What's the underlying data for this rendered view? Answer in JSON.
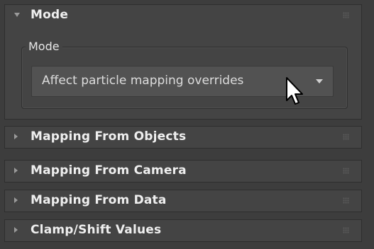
{
  "rollouts": [
    {
      "title": "Mode",
      "expanded": true
    },
    {
      "title": "Mapping From Objects",
      "expanded": false
    },
    {
      "title": "Mapping From Camera",
      "expanded": false
    },
    {
      "title": "Mapping From Data",
      "expanded": false
    },
    {
      "title": "Clamp/Shift Values",
      "expanded": false
    }
  ],
  "mode_group": {
    "label": "Mode",
    "dropdown": {
      "selected": "Affect particle mapping overrides"
    }
  },
  "icons": {
    "expanded": "triangle-down-icon",
    "collapsed": "triangle-right-icon",
    "grip": "drag-grip-icon",
    "dropdown_arrow": "chevron-down-icon",
    "cursor": "mouse-cursor-icon"
  }
}
